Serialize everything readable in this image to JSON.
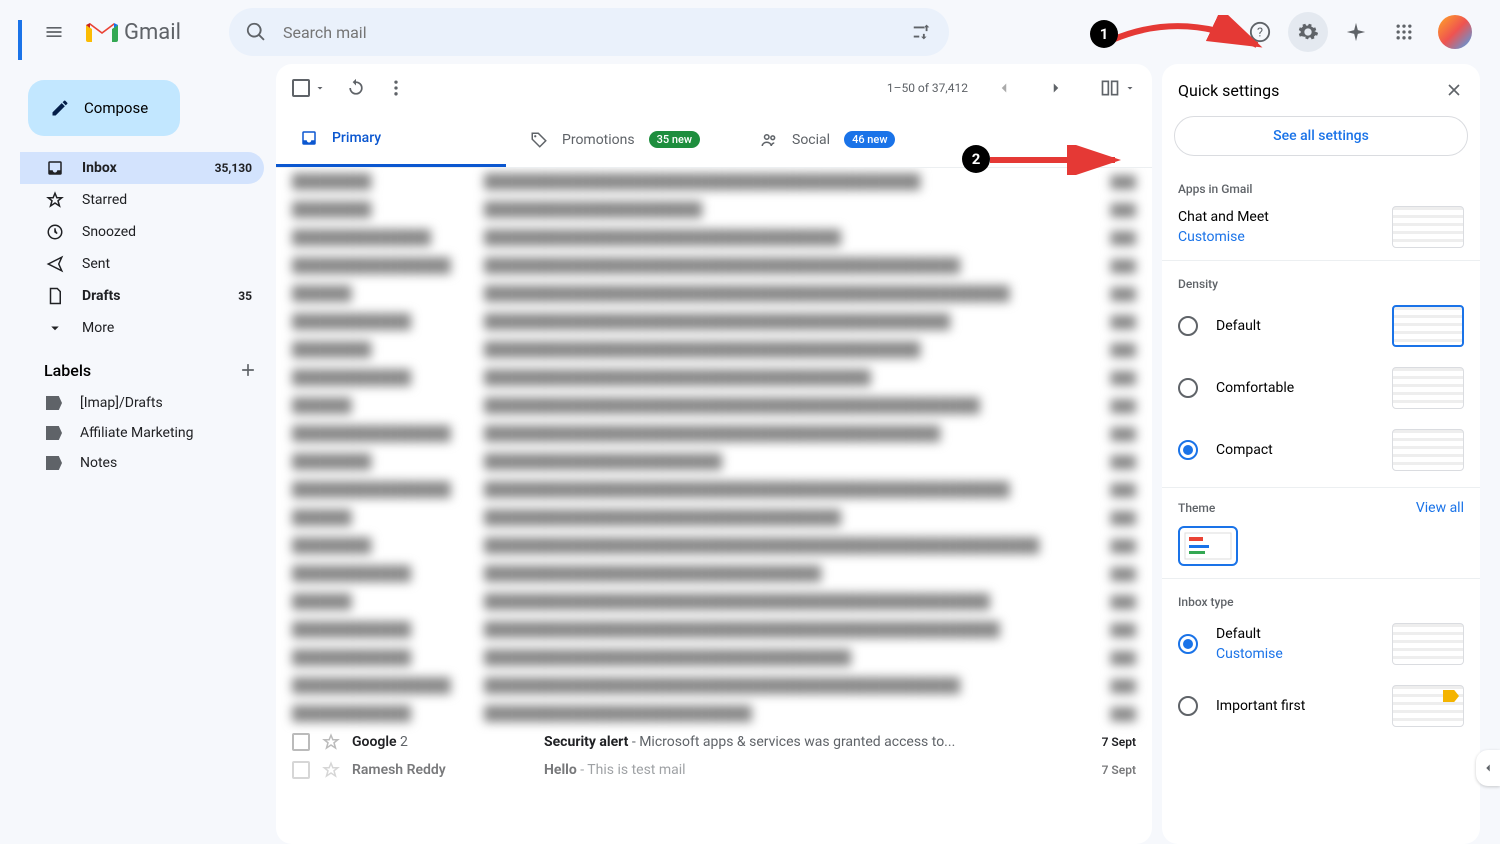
{
  "header": {
    "app_name": "Gmail",
    "search_placeholder": "Search mail"
  },
  "compose_label": "Compose",
  "nav": [
    {
      "icon": "inbox",
      "label": "Inbox",
      "count": "35,130",
      "active": true,
      "bold": true
    },
    {
      "icon": "star",
      "label": "Starred"
    },
    {
      "icon": "clock",
      "label": "Snoozed"
    },
    {
      "icon": "send",
      "label": "Sent"
    },
    {
      "icon": "file",
      "label": "Drafts",
      "count": "35",
      "bold": true
    },
    {
      "icon": "chev",
      "label": "More"
    }
  ],
  "labels_header": "Labels",
  "labels": [
    "[Imap]/Drafts",
    "Affiliate Marketing",
    "Notes"
  ],
  "toolbar": {
    "range": "1–50 of 37,412"
  },
  "tabs": [
    {
      "label": "Primary",
      "active": true
    },
    {
      "label": "Promotions",
      "badge": "35 new",
      "badgeClass": "badge-g"
    },
    {
      "label": "Social",
      "badge": "46 new",
      "badgeClass": "badge-b"
    }
  ],
  "visible_rows": [
    {
      "sender": "Google",
      "sender_suffix": "2",
      "subject": "Security alert",
      "snippet": " - Microsoft apps & services was granted access to...",
      "date": "7 Sept"
    },
    {
      "sender": "Ramesh Reddy",
      "subject": "Hello",
      "snippet": " - This is test mail",
      "date": "7 Sept"
    }
  ],
  "qs": {
    "title": "Quick settings",
    "see_all": "See all settings",
    "apps_title": "Apps in Gmail",
    "chat_meet": "Chat and Meet",
    "customise": "Customise",
    "density_title": "Density",
    "density_options": [
      "Default",
      "Comfortable",
      "Compact"
    ],
    "density_selected": "Compact",
    "theme_title": "Theme",
    "view_all": "View all",
    "inbox_type_title": "Inbox type",
    "inbox_types": [
      {
        "label": "Default",
        "customise": "Customise",
        "selected": true
      },
      {
        "label": "Important first",
        "selected": false
      }
    ]
  },
  "annotations": {
    "step1": "1",
    "step2": "2"
  }
}
